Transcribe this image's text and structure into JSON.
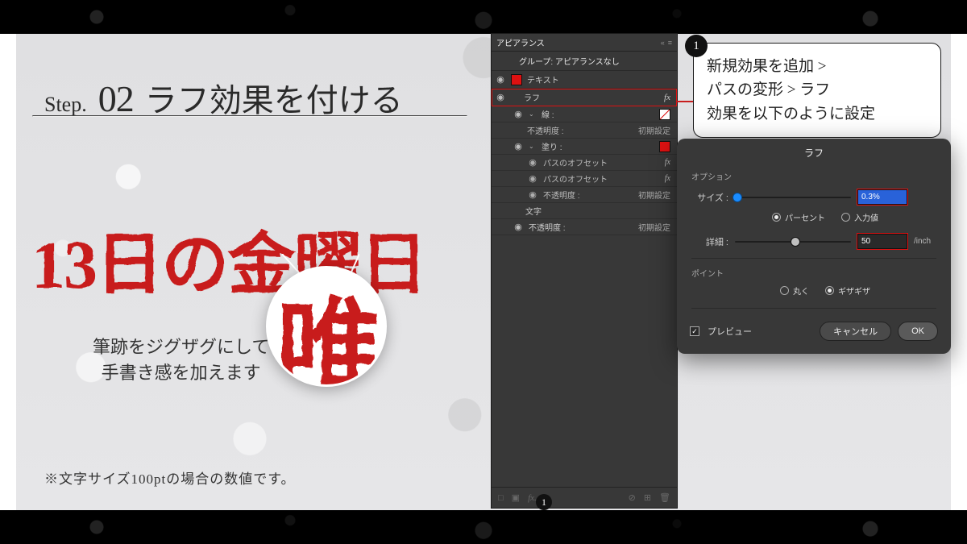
{
  "step": {
    "prefix": "Step.",
    "num": "02",
    "title": "ラフ効果を付ける"
  },
  "sample": "13日の金曜日",
  "zoom_char": "唯",
  "desc_l1": "筆跡をジグザグにして",
  "desc_l2": "手書き感を加えます",
  "footnote": "※文字サイズ100ptの場合の数値です。",
  "panel": {
    "title": "アピアランス",
    "group": "グループ: アピアランスなし",
    "text": "テキスト",
    "rough": "ラフ",
    "fx": "fx",
    "stroke": "線 :",
    "opacity": "不透明度 :",
    "opacity_val": "初期設定",
    "fill": "塗り :",
    "pathoffset": "パスのオフセット",
    "chars": "文字"
  },
  "callout": {
    "badge": "1",
    "l1": "新規効果を追加 >",
    "l2": "パスの変形 > ラフ",
    "l3": "効果を以下のように設定"
  },
  "dialog": {
    "title": "ラフ",
    "sect_options": "オプション",
    "size_label": "サイズ :",
    "size_val": "0.3%",
    "radio_percent": "パーセント",
    "radio_input": "入力値",
    "detail_label": "詳細 :",
    "detail_val": "50",
    "detail_unit": "/inch",
    "sect_point": "ポイント",
    "radio_round": "丸く",
    "radio_jagged": "ギザギザ",
    "preview": "プレビュー",
    "cancel": "キャンセル",
    "ok": "OK"
  },
  "fx_badge": "1"
}
